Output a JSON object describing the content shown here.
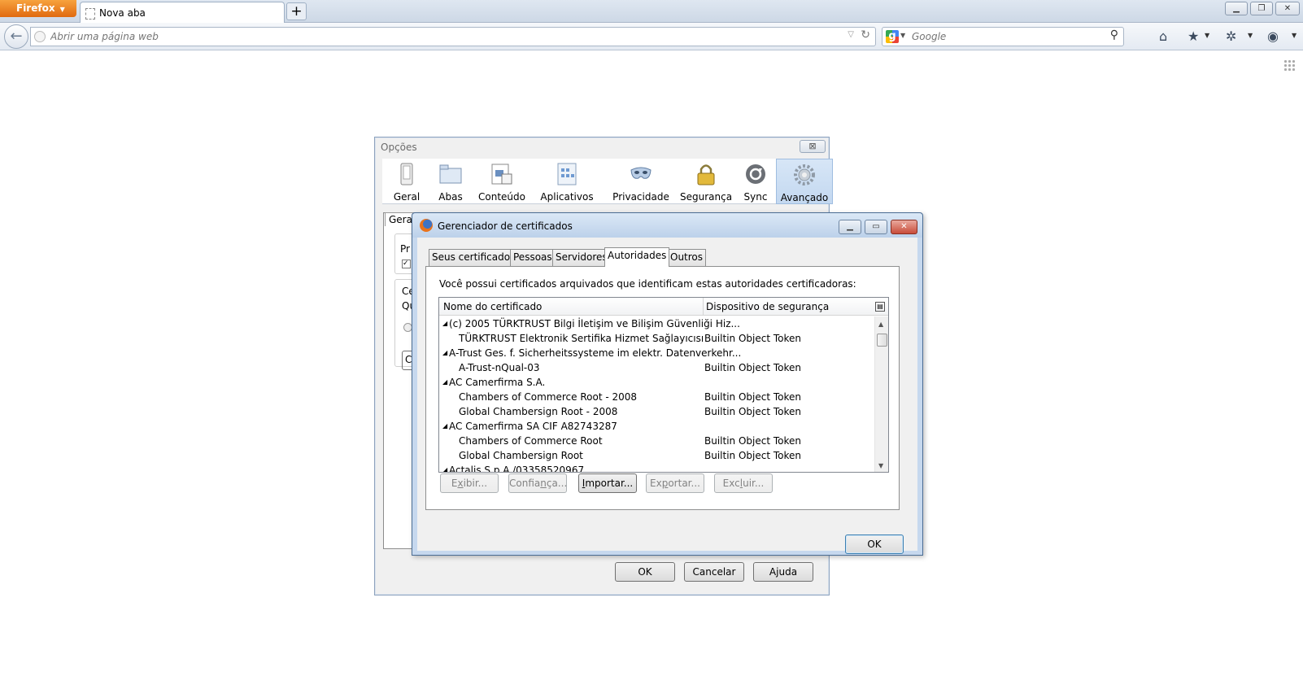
{
  "browser": {
    "menu_button": "Firefox",
    "tab_title": "Nova aba",
    "new_tab": "+",
    "url_placeholder": "Abrir uma página web",
    "search_placeholder": "Google"
  },
  "options": {
    "title": "Opções",
    "close": "⊠",
    "panes": [
      "Geral",
      "Abas",
      "Conteúdo",
      "Aplicativos",
      "Privacidade",
      "Segurança",
      "Sync",
      "Avançado"
    ],
    "selected_pane": "Avançado",
    "sub_tab": "Geral",
    "fragments": [
      "Pr",
      "Ce",
      "Qu",
      "C"
    ],
    "buttons": {
      "ok": "OK",
      "cancel": "Cancelar",
      "help_prefix": "A",
      "help_ul": "j",
      "help_suffix": "uda"
    }
  },
  "cert_manager": {
    "title": "Gerenciador de certificados",
    "tabs": [
      "Seus certificados",
      "Pessoas",
      "Servidores",
      "Autoridades",
      "Outros"
    ],
    "selected_tab": "Autoridades",
    "description": "Você possui certificados arquivados que identificam estas autoridades certificadoras:",
    "columns": [
      "Nome do certificado",
      "Dispositivo de segurança"
    ],
    "rows": [
      {
        "name": "(c) 2005 TÜRKTRUST Bilgi İletişim ve Bilişim Güvenliği Hiz...",
        "device": "",
        "group": true
      },
      {
        "name": "TÜRKTRUST Elektronik Sertifika Hizmet Sağlayıcısı",
        "device": "Builtin Object Token",
        "group": false
      },
      {
        "name": "A-Trust Ges. f. Sicherheitssysteme im elektr. Datenverkehr...",
        "device": "",
        "group": true
      },
      {
        "name": "A-Trust-nQual-03",
        "device": "Builtin Object Token",
        "group": false
      },
      {
        "name": "AC Camerfirma S.A.",
        "device": "",
        "group": true
      },
      {
        "name": "Chambers of Commerce Root - 2008",
        "device": "Builtin Object Token",
        "group": false
      },
      {
        "name": "Global Chambersign Root - 2008",
        "device": "Builtin Object Token",
        "group": false
      },
      {
        "name": "AC Camerfirma SA CIF A82743287",
        "device": "",
        "group": true
      },
      {
        "name": "Chambers of Commerce Root",
        "device": "Builtin Object Token",
        "group": false
      },
      {
        "name": "Global Chambersign Root",
        "device": "Builtin Object Token",
        "group": false
      },
      {
        "name": "Actalis S.p.A./03358520967",
        "device": "",
        "group": true
      }
    ],
    "buttons": [
      {
        "id": "view",
        "pre": "E",
        "ul": "x",
        "post": "ibir...",
        "enabled": false
      },
      {
        "id": "trust",
        "pre": "Confia",
        "ul": "n",
        "post": "ça...",
        "enabled": false
      },
      {
        "id": "import",
        "pre": "",
        "ul": "I",
        "post": "mportar...",
        "enabled": true
      },
      {
        "id": "export",
        "pre": "Ex",
        "ul": "p",
        "post": "ortar...",
        "enabled": false
      },
      {
        "id": "delete",
        "pre": "Exc",
        "ul": "l",
        "post": "uir...",
        "enabled": false
      }
    ],
    "ok": "OK"
  },
  "colors": {
    "firefox_orange": "#e8781a",
    "selection_blue": "#c3d8f0"
  }
}
